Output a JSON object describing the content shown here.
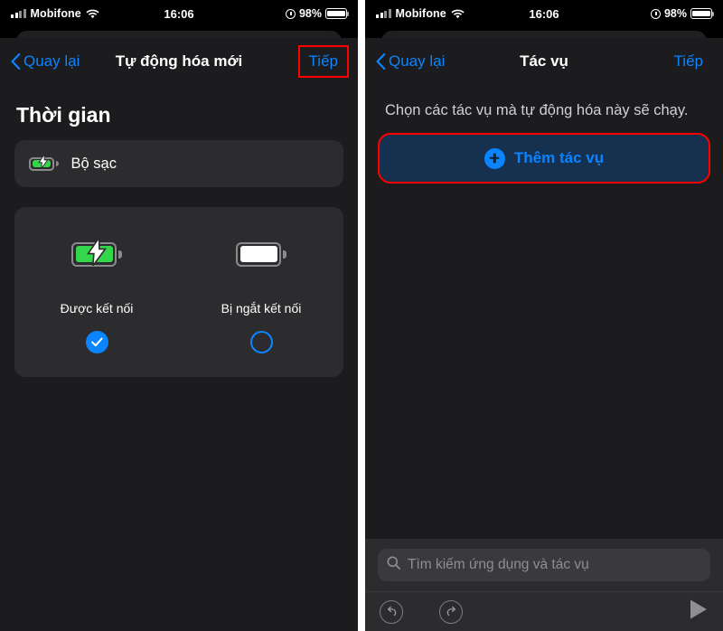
{
  "status_bar": {
    "carrier": "Mobifone",
    "time": "16:06",
    "battery_percent": "98%",
    "signal_icon": "cellular-bars-icon",
    "wifi_icon": "wifi-icon",
    "lock_icon": "screen-lock-rotation-icon",
    "battery_icon": "battery-icon"
  },
  "colors": {
    "accent_blue": "#0a84ff",
    "highlight_red": "#ff0000",
    "panel_bg": "#1c1c1e",
    "card_bg": "#2c2c2e",
    "battery_green": "#32d74b",
    "add_button_bg": "#15314f"
  },
  "left_panel": {
    "nav": {
      "back_label": "Quay lại",
      "title": "Tự động hóa mới",
      "next_label": "Tiếp",
      "next_highlighted": true
    },
    "section_title": "Thời gian",
    "trigger_row": {
      "label": "Bộ sạc",
      "icon": "battery-charging-icon"
    },
    "choices": [
      {
        "label": "Được kết nối",
        "icon": "battery-charging-icon",
        "selected": true
      },
      {
        "label": "Bị ngắt kết nối",
        "icon": "battery-full-icon",
        "selected": false
      }
    ]
  },
  "right_panel": {
    "nav": {
      "back_label": "Quay lại",
      "title": "Tác vụ",
      "next_label": "Tiếp",
      "next_highlighted": false
    },
    "description": "Chọn các tác vụ mà tự động hóa này sẽ chạy.",
    "add_action_button": {
      "label": "Thêm tác vụ",
      "icon": "plus-circle-icon",
      "highlighted": true
    },
    "search": {
      "placeholder": "Tìm kiếm ứng dụng và tác vụ",
      "icon": "search-icon",
      "value": ""
    },
    "toolbar": {
      "undo_icon": "undo-icon",
      "redo_icon": "redo-icon",
      "play_icon": "play-icon"
    }
  }
}
